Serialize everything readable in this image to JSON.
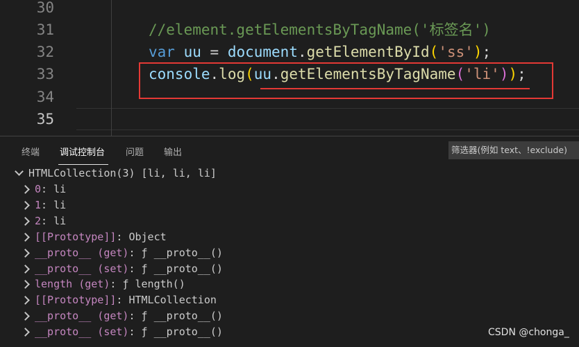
{
  "editor": {
    "line_numbers": [
      "30",
      "31",
      "32",
      "33",
      "34",
      "35"
    ],
    "line31": {
      "comment": "//element.getElementsByTagName('标签名')"
    },
    "line32": {
      "kw": "var",
      "sp1": " ",
      "var": "uu",
      "eq": " = ",
      "obj": "document",
      "dot": ".",
      "fn": "getElementById",
      "p1": "(",
      "str": "'ss'",
      "p2": ")",
      "semi": ";"
    },
    "line33": {
      "obj": "console",
      "dot1": ".",
      "fn1": "log",
      "p1": "(",
      "var": "uu",
      "dot2": ".",
      "fn2": "getElementsByTagName",
      "p2": "(",
      "str": "'li'",
      "p3": ")",
      "p4": ")",
      "semi": ";"
    }
  },
  "panel": {
    "tabs": [
      "终端",
      "调试控制台",
      "问题",
      "输出"
    ],
    "filter_placeholder": "筛选器(例如 text、!exclude)"
  },
  "console": {
    "root": "HTMLCollection(3) [li, li, li]",
    "rows": [
      {
        "key": "0",
        "sep": ": ",
        "val": "li"
      },
      {
        "key": "1",
        "sep": ": ",
        "val": "li"
      },
      {
        "key": "2",
        "sep": ": ",
        "val": "li"
      },
      {
        "key": "[[Prototype]]",
        "sep": ": ",
        "val": "Object"
      },
      {
        "key": "__proto__ (get)",
        "sep": ": ",
        "val": "ƒ __proto__()"
      },
      {
        "key": "__proto__ (set)",
        "sep": ": ",
        "val": "ƒ __proto__()"
      },
      {
        "key": "length (get)",
        "sep": ": ",
        "val": "ƒ length()"
      },
      {
        "key": "[[Prototype]]",
        "sep": ": ",
        "val": "HTMLCollection"
      },
      {
        "key": "__proto__ (get)",
        "sep": ": ",
        "val": "ƒ __proto__()"
      },
      {
        "key": "__proto__ (set)",
        "sep": ": ",
        "val": "ƒ __proto__()"
      }
    ]
  },
  "watermark": "CSDN @chonga_"
}
